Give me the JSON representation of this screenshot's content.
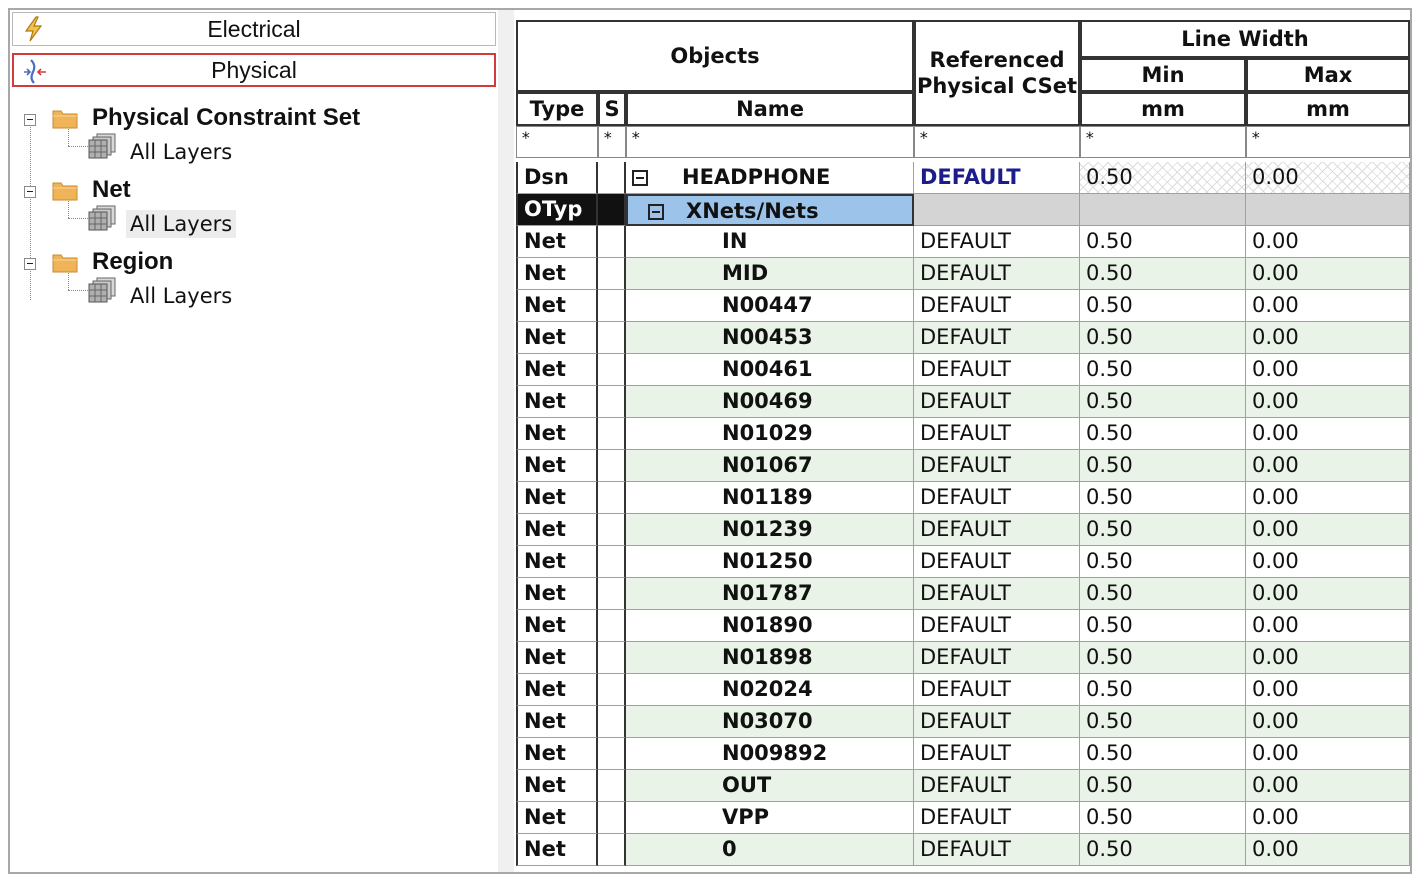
{
  "nav": {
    "electrical_label": "Electrical",
    "physical_label": "Physical"
  },
  "tree": [
    {
      "label": "Physical Constraint Set",
      "child": "All Layers"
    },
    {
      "label": "Net",
      "child": "All Layers"
    },
    {
      "label": "Region",
      "child": "All Layers"
    }
  ],
  "grid": {
    "headers": {
      "objects": "Objects",
      "type": "Type",
      "s": "S",
      "name": "Name",
      "referenced": "Referenced Physical CSet",
      "line_width": "Line Width",
      "min": "Min",
      "max": "Max",
      "min_unit": "mm",
      "max_unit": "mm"
    },
    "filter_value": "*",
    "dsn_row": {
      "type": "Dsn",
      "name": "HEADPHONE",
      "cset": "DEFAULT",
      "min": "0.50",
      "max": "0.00"
    },
    "otyp_row": {
      "type": "OTyp",
      "name": "XNets/Nets"
    },
    "rows": [
      {
        "type": "Net",
        "name": "IN",
        "cset": "DEFAULT",
        "min": "0.50",
        "max": "0.00"
      },
      {
        "type": "Net",
        "name": "MID",
        "cset": "DEFAULT",
        "min": "0.50",
        "max": "0.00"
      },
      {
        "type": "Net",
        "name": "N00447",
        "cset": "DEFAULT",
        "min": "0.50",
        "max": "0.00"
      },
      {
        "type": "Net",
        "name": "N00453",
        "cset": "DEFAULT",
        "min": "0.50",
        "max": "0.00"
      },
      {
        "type": "Net",
        "name": "N00461",
        "cset": "DEFAULT",
        "min": "0.50",
        "max": "0.00"
      },
      {
        "type": "Net",
        "name": "N00469",
        "cset": "DEFAULT",
        "min": "0.50",
        "max": "0.00"
      },
      {
        "type": "Net",
        "name": "N01029",
        "cset": "DEFAULT",
        "min": "0.50",
        "max": "0.00"
      },
      {
        "type": "Net",
        "name": "N01067",
        "cset": "DEFAULT",
        "min": "0.50",
        "max": "0.00"
      },
      {
        "type": "Net",
        "name": "N01189",
        "cset": "DEFAULT",
        "min": "0.50",
        "max": "0.00"
      },
      {
        "type": "Net",
        "name": "N01239",
        "cset": "DEFAULT",
        "min": "0.50",
        "max": "0.00"
      },
      {
        "type": "Net",
        "name": "N01250",
        "cset": "DEFAULT",
        "min": "0.50",
        "max": "0.00"
      },
      {
        "type": "Net",
        "name": "N01787",
        "cset": "DEFAULT",
        "min": "0.50",
        "max": "0.00"
      },
      {
        "type": "Net",
        "name": "N01890",
        "cset": "DEFAULT",
        "min": "0.50",
        "max": "0.00"
      },
      {
        "type": "Net",
        "name": "N01898",
        "cset": "DEFAULT",
        "min": "0.50",
        "max": "0.00"
      },
      {
        "type": "Net",
        "name": "N02024",
        "cset": "DEFAULT",
        "min": "0.50",
        "max": "0.00"
      },
      {
        "type": "Net",
        "name": "N03070",
        "cset": "DEFAULT",
        "min": "0.50",
        "max": "0.00"
      },
      {
        "type": "Net",
        "name": "N009892",
        "cset": "DEFAULT",
        "min": "0.50",
        "max": "0.00"
      },
      {
        "type": "Net",
        "name": "OUT",
        "cset": "DEFAULT",
        "min": "0.50",
        "max": "0.00"
      },
      {
        "type": "Net",
        "name": "VPP",
        "cset": "DEFAULT",
        "min": "0.50",
        "max": "0.00"
      },
      {
        "type": "Net",
        "name": "0",
        "cset": "DEFAULT",
        "min": "0.50",
        "max": "0.00"
      }
    ]
  }
}
